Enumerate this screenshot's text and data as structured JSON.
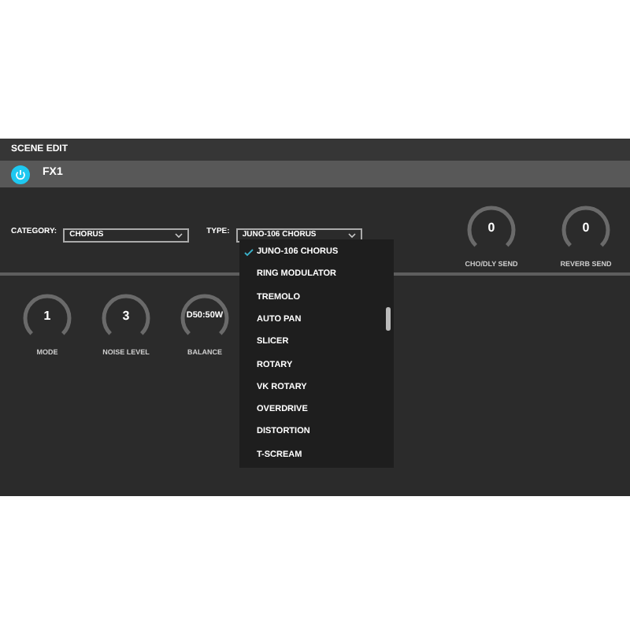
{
  "header": {
    "title": "SCENE EDIT"
  },
  "fx_bar": {
    "power_on": true,
    "name": "FX1"
  },
  "category": {
    "label": "CATEGORY:",
    "value": "CHORUS"
  },
  "type": {
    "label": "TYPE:",
    "value": "JUNO-106 CHORUS"
  },
  "send_knobs": [
    {
      "value": "0",
      "label": "CHO/DLY SEND"
    },
    {
      "value": "0",
      "label": "REVERB SEND"
    }
  ],
  "knobs": [
    {
      "value": "1",
      "label": "MODE"
    },
    {
      "value": "3",
      "label": "NOISE LEVEL"
    },
    {
      "value": "D50:50W",
      "label": "BALANCE"
    }
  ],
  "type_menu": {
    "items": [
      {
        "label": "JUNO-106 CHORUS",
        "selected": true
      },
      {
        "label": "RING MODULATOR",
        "selected": false
      },
      {
        "label": "TREMOLO",
        "selected": false
      },
      {
        "label": "AUTO PAN",
        "selected": false
      },
      {
        "label": "SLICER",
        "selected": false
      },
      {
        "label": "ROTARY",
        "selected": false
      },
      {
        "label": "VK ROTARY",
        "selected": false
      },
      {
        "label": "OVERDRIVE",
        "selected": false
      },
      {
        "label": "DISTORTION",
        "selected": false
      },
      {
        "label": "T-SCREAM",
        "selected": false
      }
    ]
  }
}
